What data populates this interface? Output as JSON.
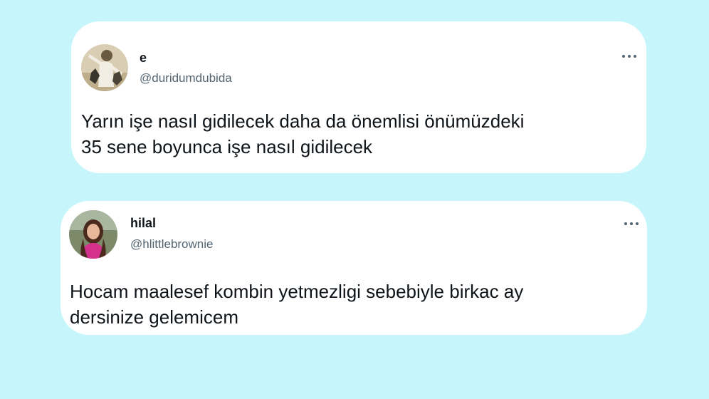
{
  "tweets": [
    {
      "display_name": "e",
      "handle": "@duridumdubida",
      "text_line1": "Yarın işe nasıl gidilecek daha da önemlisi önümüzdeki",
      "text_line2": "35 sene boyunca işe nasıl gidilecek",
      "more_icon": "more-horizontal-icon"
    },
    {
      "display_name": "hilal",
      "handle": "@hlittlebrownie",
      "text_line1": "Hocam maalesef kombin yetmezligi sebebiyle birkac ay",
      "text_line2": "dersinize gelemicem",
      "more_icon": "more-horizontal-icon"
    }
  ],
  "colors": {
    "background": "#c6f6fb",
    "card": "#ffffff",
    "text_primary": "#0f1419",
    "text_secondary": "#536471"
  }
}
